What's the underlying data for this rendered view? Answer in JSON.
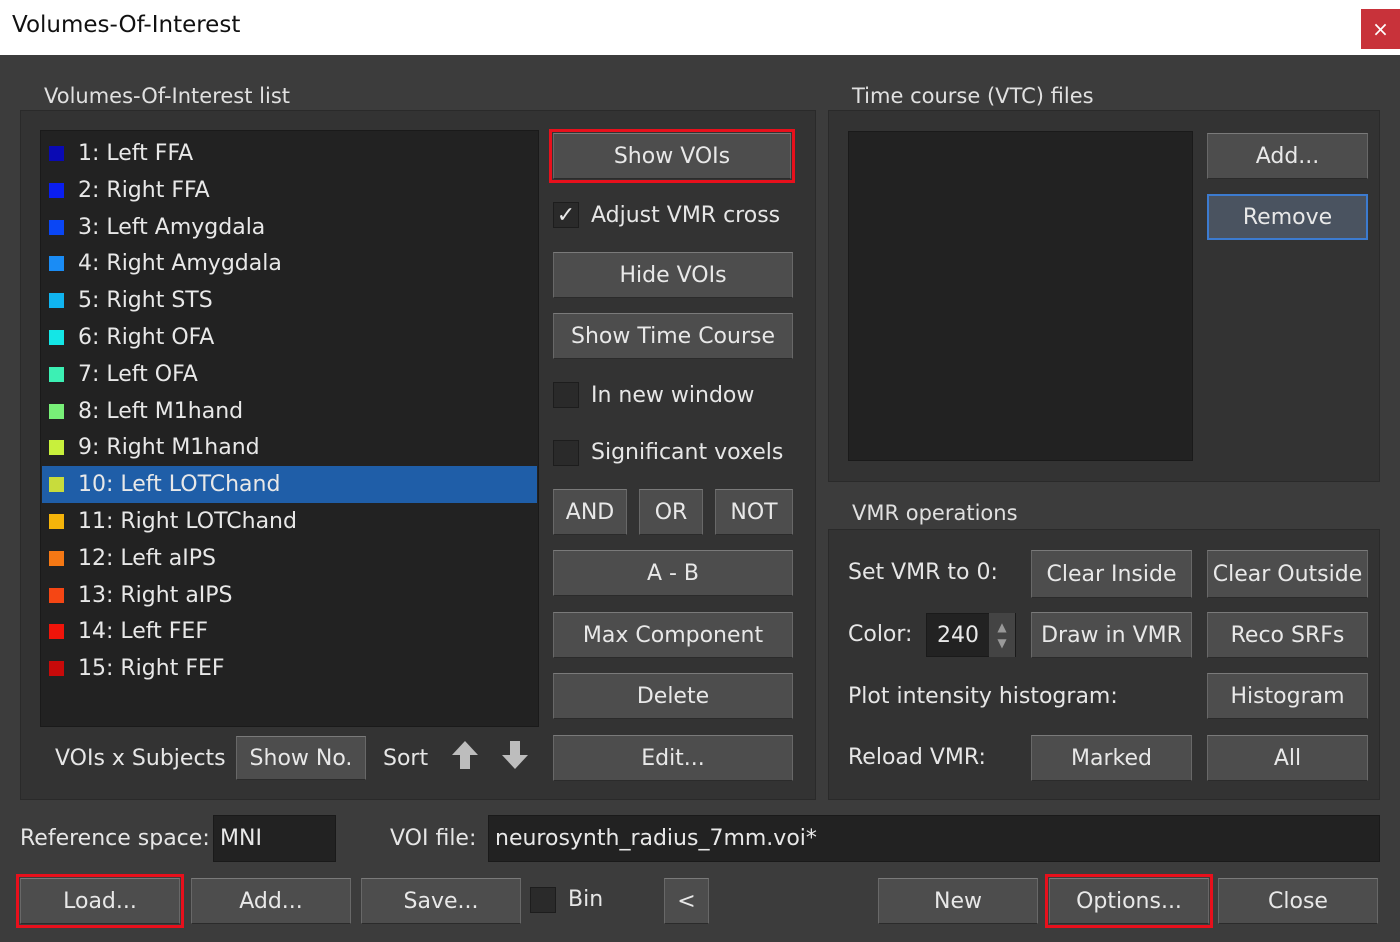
{
  "window": {
    "title": "Volumes-Of-Interest",
    "close_label": "×"
  },
  "voi_list": {
    "label": "Volumes-Of-Interest list",
    "items": [
      {
        "label": "1: Left FFA",
        "color": "#0a0ab4"
      },
      {
        "label": "2: Right FFA",
        "color": "#0a1ef0"
      },
      {
        "label": "3: Left Amygdala",
        "color": "#0a46f5"
      },
      {
        "label": "4: Right Amygdala",
        "color": "#1a8cf5"
      },
      {
        "label": "5: Right STS",
        "color": "#10b4f0"
      },
      {
        "label": "6: Right OFA",
        "color": "#14e6e6"
      },
      {
        "label": "7: Left OFA",
        "color": "#3cf0b4"
      },
      {
        "label": "8: Left M1hand",
        "color": "#78f078"
      },
      {
        "label": "9: Right M1hand",
        "color": "#c8f03c"
      },
      {
        "label": "10: Left LOTChand",
        "color": "#c8dc3c"
      },
      {
        "label": "11: Right LOTChand",
        "color": "#f5b40a"
      },
      {
        "label": "12: Left aIPS",
        "color": "#f57814"
      },
      {
        "label": "13: Right aIPS",
        "color": "#f54614"
      },
      {
        "label": "14: Left FEF",
        "color": "#f0140a"
      },
      {
        "label": "15: Right FEF",
        "color": "#c80a0a"
      }
    ],
    "selected_index": 9,
    "selected_color": "#1f5ea8"
  },
  "voi_controls": {
    "show_vois": "Show VOIs",
    "adjust_vmr_cross": "Adjust VMR cross",
    "adjust_checked": "✓",
    "hide_vois": "Hide VOIs",
    "show_time_course": "Show Time Course",
    "in_new_window": "In new window",
    "significant_voxels": "Significant voxels",
    "and": "AND",
    "or": "OR",
    "not": "NOT",
    "a_minus_b": "A - B",
    "max_component": "Max Component",
    "delete": "Delete",
    "edit": "Edit..."
  },
  "subjects_row": {
    "label": "VOIs x Subjects",
    "show_no": "Show No.",
    "sort": "Sort",
    "up_icon": "arrow-up-icon",
    "down_icon": "arrow-down-icon"
  },
  "vtc": {
    "label": "Time course (VTC) files",
    "add": "Add...",
    "remove": "Remove"
  },
  "vmr_ops": {
    "label": "VMR operations",
    "set_vmr_label": "Set VMR to 0:",
    "clear_inside": "Clear Inside",
    "clear_outside": "Clear Outside",
    "color_label": "Color:",
    "color_value": "240",
    "draw_in_vmr": "Draw in VMR",
    "reco_srfs": "Reco SRFs",
    "plot_hist_label": "Plot intensity histogram:",
    "histogram": "Histogram",
    "reload_label": "Reload VMR:",
    "marked": "Marked",
    "all": "All"
  },
  "bottom": {
    "ref_space_label": "Reference space:",
    "ref_space_value": "MNI",
    "voi_file_label": "VOI file:",
    "voi_file_value": "neurosynth_radius_7mm.voi*",
    "load": "Load...",
    "add": "Add...",
    "save": "Save...",
    "bin": "Bin",
    "lt": "<",
    "new": "New",
    "options": "Options...",
    "close": "Close"
  }
}
